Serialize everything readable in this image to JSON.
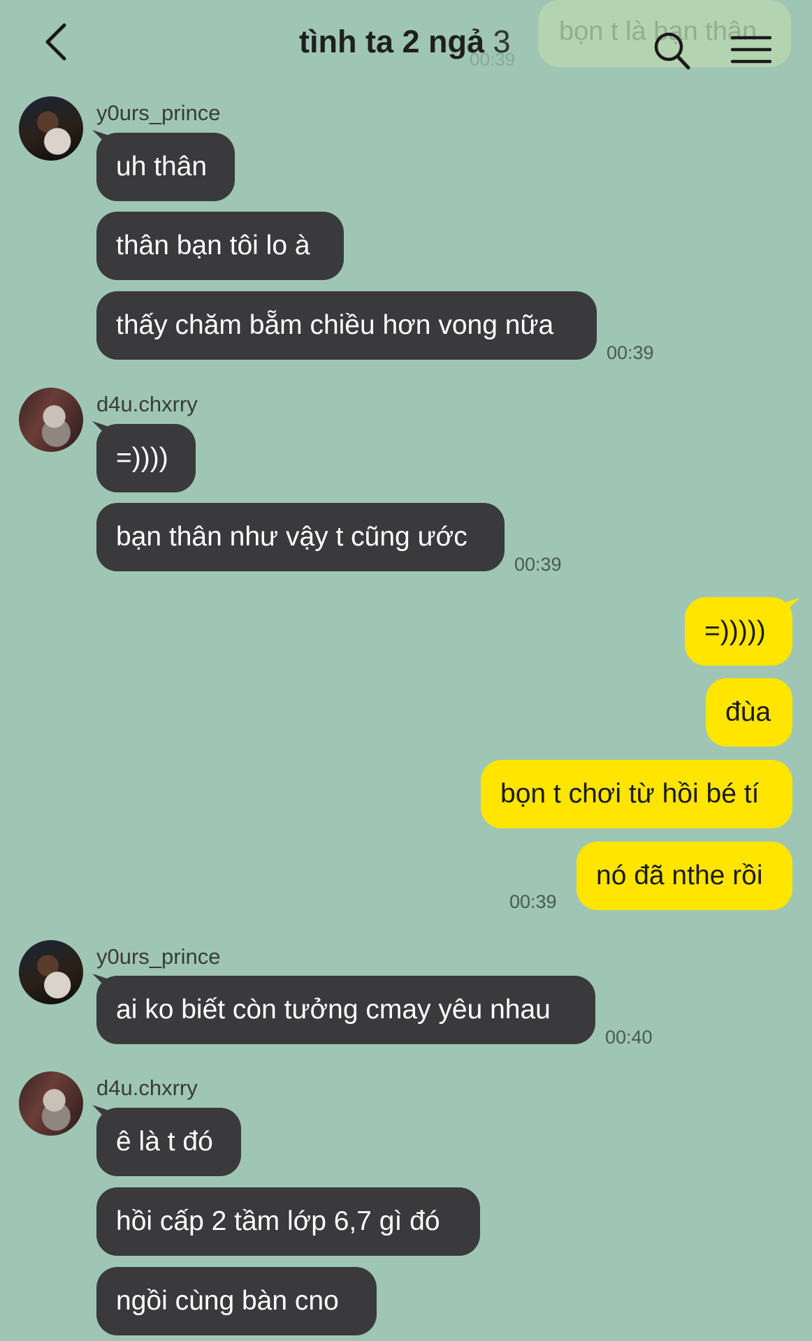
{
  "header": {
    "title": "tình ta 2 ngả",
    "member_count": "3",
    "back_icon": "chevron-left-icon",
    "search_icon": "search-icon",
    "menu_icon": "hamburger-menu-icon",
    "ghost_message": "bọn t là bạn thân",
    "ghost_time": "00:39"
  },
  "messages": {
    "g1": {
      "sender": "y0urs_prince",
      "texts": [
        "uh thân",
        "thân bạn tôi lo à",
        "thấy chăm bẵm chiều hơn vong nữa"
      ],
      "time": "00:39"
    },
    "g2": {
      "sender": "d4u.chxrry",
      "texts": [
        "=))))",
        "bạn thân như vậy t cũng ước"
      ],
      "time": "00:39"
    },
    "g3": {
      "sender": "me",
      "texts": [
        "=)))))",
        "đùa",
        "bọn t chơi từ hồi bé tí",
        "nó đã nthe rồi"
      ],
      "time": "00:39"
    },
    "g4": {
      "sender": "y0urs_prince",
      "texts": [
        "ai ko biết còn tưởng cmay yêu nhau"
      ],
      "time": "00:40"
    },
    "g5": {
      "sender": "d4u.chxrry",
      "texts": [
        "ê là t đó",
        "hồi cấp 2 tầm lớp 6,7 gì đó",
        "ngồi cùng bàn cno"
      ]
    }
  },
  "colors": {
    "background": "#9fc6b4",
    "incoming_bubble": "#3a3a3c",
    "outgoing_bubble": "#ffe500"
  }
}
